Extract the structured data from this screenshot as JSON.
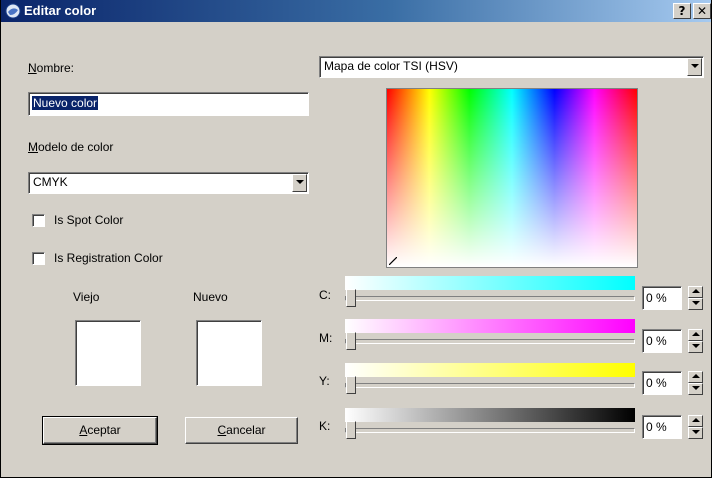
{
  "window": {
    "title": "Editar color",
    "help_label": "?",
    "close_label": "✕"
  },
  "left": {
    "name_label_prefix": "N",
    "name_label_rest": "ombre:",
    "name_value": "Nuevo color",
    "model_label_prefix": "M",
    "model_label_rest": "odelo de color",
    "model_value": "CMYK",
    "spot_label": "Is Spot Color",
    "spot_checked": false,
    "registration_label": "Is Registration Color",
    "registration_checked": false,
    "old_label": "Viejo",
    "new_label": "Nuevo",
    "old_swatch_color": "#ffffff",
    "new_swatch_color": "#ffffff",
    "accept_prefix": "A",
    "accept_rest": "ceptar",
    "cancel_prefix": "C",
    "cancel_rest": "ancelar"
  },
  "right": {
    "map_value": "Mapa de color TSI (HSV)",
    "channels": [
      {
        "label": "C:",
        "value": "0 %",
        "level": 0,
        "ramp_from": "#ffffff",
        "ramp_to": "#00ffff"
      },
      {
        "label": "M:",
        "value": "0 %",
        "level": 0,
        "ramp_from": "#ffffff",
        "ramp_to": "#ff00ff"
      },
      {
        "label": "Y:",
        "value": "0 %",
        "level": 0,
        "ramp_from": "#ffffff",
        "ramp_to": "#ffff00"
      },
      {
        "label": "K:",
        "value": "0 %",
        "level": 0,
        "ramp_from": "#ffffff",
        "ramp_to": "#000000"
      }
    ]
  }
}
